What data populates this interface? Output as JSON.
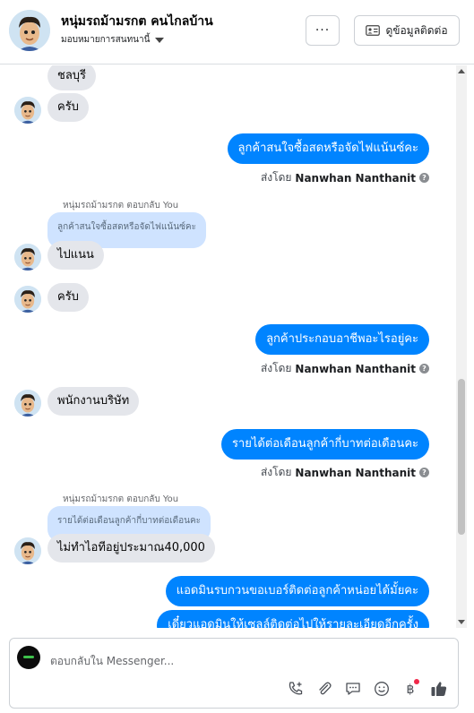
{
  "header": {
    "title": "หนุ่มรถม้ามรกต คนไกลบ้าน",
    "subtitle": "มอบหมายการสนทนานี้",
    "more_label": "···",
    "contact_label": "ดูข้อมูลติดต่อ"
  },
  "messages": {
    "m1": "ชลบุรี",
    "m2": "ครับ",
    "m3": "ลูกค้าสนใจซื้อสดหรือจัดไฟแน้นซ์คะ",
    "m4_reply_meta": "หนุ่มรถม้ามรกต ตอบกลับ You",
    "m4_quote": "ลูกค้าสนใจซื้อสดหรือจัดไฟแน้นซ์คะ",
    "m4": "ไปแนน",
    "m5": "ครับ",
    "m6": "ลูกค้าประกอบอาชีพอะไรอยู่คะ",
    "m7": "พนักงานบริษัท",
    "m8": "รายได้ต่อเดือนลูกค้ากี่บาทต่อเดือนคะ",
    "m9_reply_meta": "หนุ่มรถม้ามรกต ตอบกลับ You",
    "m9_quote": "รายได้ต่อเดือนลูกค้ากี่บาทต่อเดือนคะ",
    "m9": "ไม่ทำไอทีอยู่ประมาณ40,000",
    "m10": "แอดมินรบกวนขอเบอร์ติดต่อลูกค้าหน่อยได้มั้ยคะ",
    "m11": "เดี๋ยวแอดมินให้เซลล์ติดต่อไปให้รายละเอียดอีกครั้ง"
  },
  "sent_by": {
    "prefix": "ส่งโดย",
    "name": "Nanwhan Nanthanit",
    "help": "?"
  },
  "composer": {
    "placeholder": "ตอบกลับใน Messenger..."
  },
  "icons": [
    "phone-add-icon",
    "attachment-icon",
    "chat-bubble-icon",
    "emoji-icon",
    "baht-icon",
    "thumbs-up-icon"
  ],
  "colors": {
    "outgoing": "#0084ff",
    "incoming": "#e4e6eb",
    "quote": "#cfe3ff"
  }
}
